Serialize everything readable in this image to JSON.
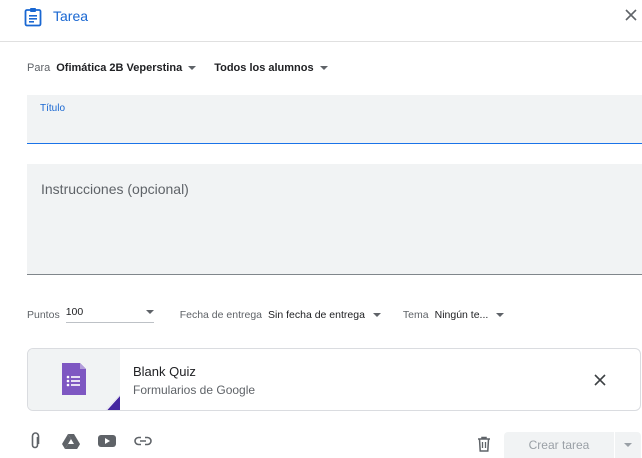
{
  "header": {
    "title": "Tarea",
    "accent_color": "#1967d2",
    "icon": "assignment-icon",
    "close_icon": "close-icon"
  },
  "audience": {
    "for_label": "Para",
    "class_name": "Ofimática 2B Veperstina",
    "students": "Todos los alumnos"
  },
  "title_field": {
    "label": "Título",
    "value": ""
  },
  "instructions_field": {
    "placeholder": "Instrucciones (opcional)",
    "value": ""
  },
  "meta": {
    "points_label": "Puntos",
    "points_value": "100",
    "due_label": "Fecha de entrega",
    "due_value": "Sin fecha de entrega",
    "topic_label": "Tema",
    "topic_value": "Ningún te..."
  },
  "attachment": {
    "title": "Blank Quiz",
    "subtitle": "Formularios de Google",
    "icon": "google-forms-icon",
    "thumb_color": "#7e57c2"
  },
  "toolbar": {
    "icons": [
      "attach-icon",
      "google-drive-icon",
      "youtube-icon",
      "link-icon"
    ],
    "delete_icon": "trash-icon",
    "create_label": "Crear tarea"
  }
}
